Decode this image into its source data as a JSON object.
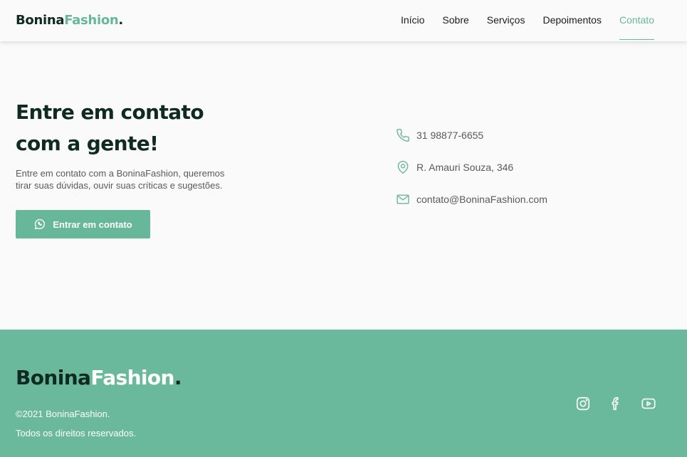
{
  "header": {
    "logo_part1": "Bonina",
    "logo_part2": "Fashion",
    "logo_dot": ".",
    "nav": [
      {
        "label": "Início"
      },
      {
        "label": "Sobre"
      },
      {
        "label": "Serviços"
      },
      {
        "label": "Depoimentos"
      },
      {
        "label": "Contato",
        "active": true
      }
    ]
  },
  "main": {
    "headline_line1": "Entre em contato",
    "headline_line2": "com a gente!",
    "description": "Entre em contato com a BoninaFashion, queremos tirar suas dúvidas, ouvir suas críticas e sugestões.",
    "cta_label": "Entrar em contato",
    "cta_icon": "whatsapp-icon",
    "contacts": [
      {
        "icon": "phone-icon",
        "text": "31 98877-6655"
      },
      {
        "icon": "map-pin-icon",
        "text": "R. Amauri Souza, 346"
      },
      {
        "icon": "mail-icon",
        "text": "contato@BoninaFashion.com"
      }
    ]
  },
  "footer": {
    "logo_part1": "Bonina",
    "logo_part2": "Fashion",
    "logo_dot": ".",
    "copyright": "©2021 BoninaFashion.",
    "rights": "Todos os direitos reservados.",
    "socials": [
      "instagram-icon",
      "facebook-icon",
      "youtube-icon"
    ]
  },
  "colors": {
    "accent": "#67b89a",
    "dark": "#0e2a22",
    "background": "#fafafa",
    "footer_bg": "#6ab99c"
  }
}
